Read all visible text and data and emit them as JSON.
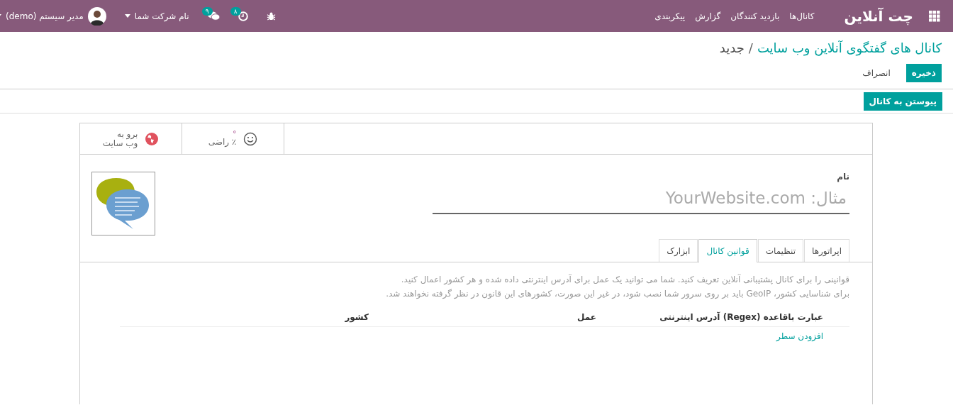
{
  "navbar": {
    "app_title": "چت آنلاین",
    "menu": [
      "کانال‌ها",
      "بازدید کنندگان",
      "گزارش",
      "پیکربندی"
    ],
    "systray": [
      {
        "kind": "debug"
      },
      {
        "kind": "activity",
        "badge": "۸"
      },
      {
        "kind": "messages",
        "badge": "۹"
      },
      {
        "kind": "company",
        "label": "نام شرکت شما"
      },
      {
        "kind": "user",
        "label": "مدیر سیستم (demo)"
      }
    ]
  },
  "breadcrumb_separator": "/",
  "breadcrumb": [
    {
      "label": "کانال های گفتگوی آنلاین وب سایت",
      "link": true
    },
    {
      "label": "جدید",
      "link": false
    }
  ],
  "buttons": [
    {
      "label": "ذخیره",
      "primary": true
    },
    {
      "label": "انصراف",
      "primary": false
    }
  ],
  "statusbar_button": "پیوستن به کانال",
  "stat_buttons": [
    {
      "kind": "rating",
      "value": "°",
      "label": "٪ راضی"
    },
    {
      "kind": "website",
      "lines": [
        "برو به",
        "وب سایت"
      ]
    }
  ],
  "name": {
    "label": "نام",
    "placeholder": "مثال: YourWebsite.com"
  },
  "tabs": [
    {
      "label": "اپراتورها",
      "selected": false
    },
    {
      "label": "تنظیمات",
      "selected": false
    },
    {
      "label": "قوانین کانال",
      "selected": true
    },
    {
      "label": "ابزارک",
      "selected": false
    }
  ],
  "help": [
    "قوانینی را برای کانال پشتیبانی آنلاین تعریف کنید. شما می توانید یک عمل برای آدرس اینترنتی داده شده و هر کشور اعمال کنید.",
    "برای شناسایی کشور، GeoIP باید بر روی سرور شما نصب شود، در غیر این صورت، کشورهای این قانون در نظر گرفته نخواهند شد."
  ],
  "table": {
    "columns": [
      "عبارت باقاعده (Regex) آدرس اینترنتی",
      "عمل",
      "کشور"
    ],
    "add_line": "افزودن سطر"
  }
}
